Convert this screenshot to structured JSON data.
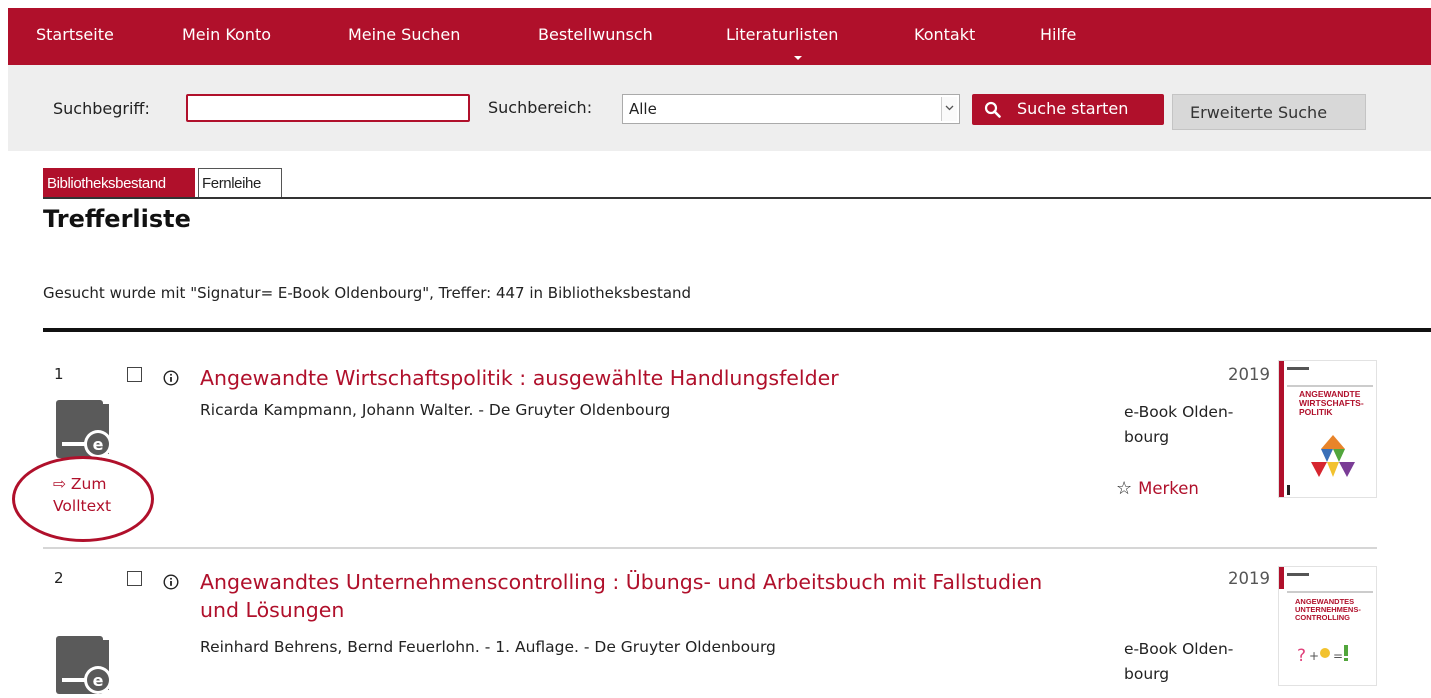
{
  "nav": {
    "items": [
      "Startseite",
      "Mein Konto",
      "Meine Suchen",
      "Bestellwunsch",
      "Literaturlisten",
      "Kontakt",
      "Hilfe"
    ]
  },
  "search": {
    "term_label": "Suchbegriff:",
    "term_value": "",
    "area_label": "Suchbereich:",
    "area_value": "Alle",
    "start_button": "Suche starten",
    "advanced_button": "Erweiterte Suche"
  },
  "tabs": [
    "Bibliotheksbestand",
    "Fernleihe"
  ],
  "results": {
    "heading": "Trefferliste",
    "info": "Gesucht wurde mit \"Signatur= E-Book Oldenbourg\", Treffer: 447 in Bibliotheksbestand",
    "items": [
      {
        "number": "1",
        "title_lines": [
          "Angewandte Wirtschaftspolitik : ausgewählte Handlungsfelder"
        ],
        "authors": "Ricarda Kampmann, Johann Walter. - De Gruyter Oldenbourg",
        "year": "2019",
        "category_lines": [
          "e-Book Olden-",
          "bourg"
        ],
        "fulltext_lines": [
          "⇨ Zum",
          "Volltext"
        ],
        "bookmark": "Merken",
        "cover_lines": [
          "ANGEWANDTE",
          "WIRTSCHAFTS-",
          "POLITIK"
        ]
      },
      {
        "number": "2",
        "title_lines": [
          "Angewandtes Unternehmenscontrolling : Übungs- und Arbeitsbuch mit Fallstudien",
          "und Lösungen"
        ],
        "authors": "Reinhard Behrens, Bernd Feuerlohn. - 1. Auflage. - De Gruyter Oldenbourg",
        "year": "2019",
        "category_lines": [
          "e-Book Olden-",
          "bourg"
        ],
        "cover_lines": [
          "ANGEWANDTES",
          "UNTERNEHMENS-",
          "CONTROLLING"
        ]
      }
    ]
  },
  "colors": {
    "brand_red": "#b0102b",
    "searchbar_bg": "#eeeeee",
    "advanced_button_bg": "#d8d8d8"
  },
  "icons": [
    "search-icon",
    "info-icon",
    "ebook-icon",
    "star-icon",
    "dropdown-arrow-icon"
  ]
}
